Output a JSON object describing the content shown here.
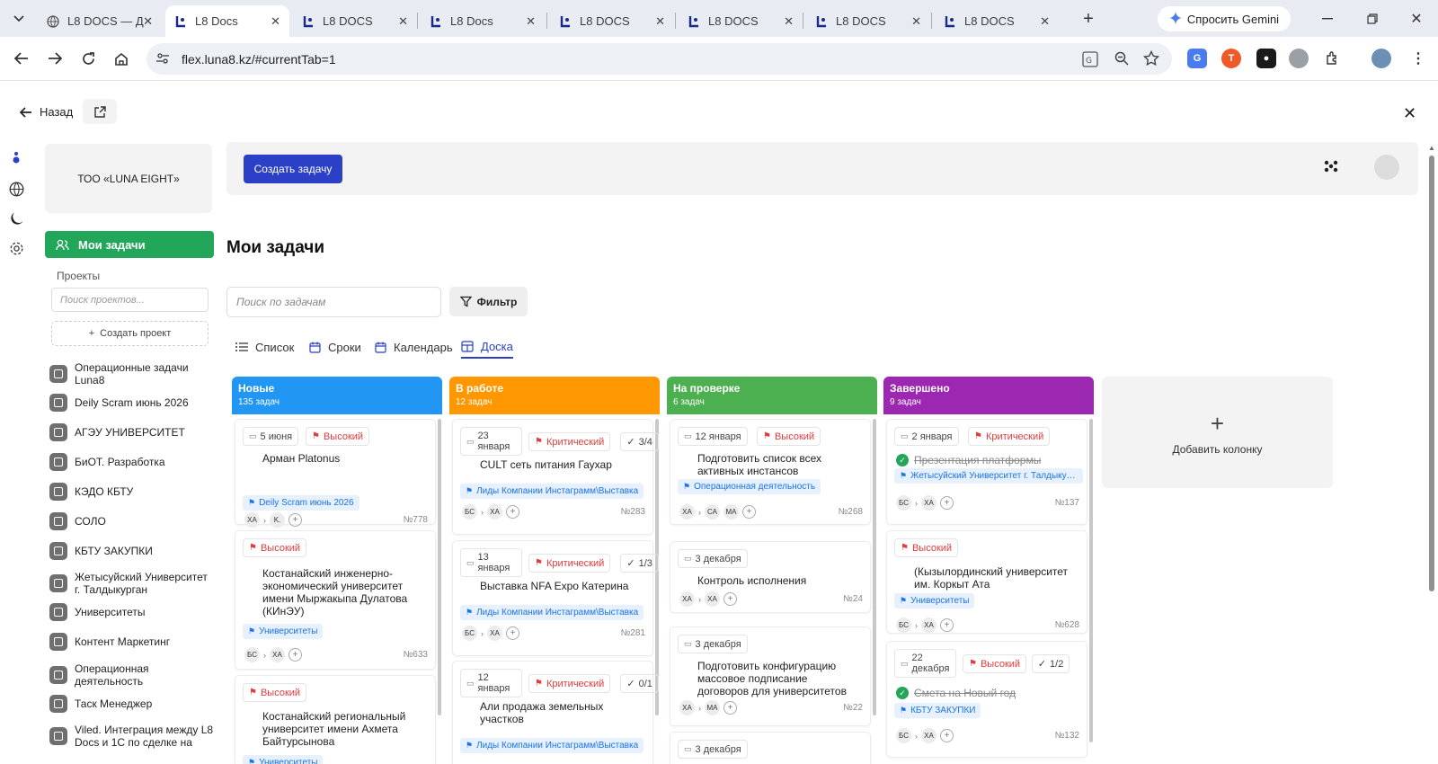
{
  "browser": {
    "tabs": [
      {
        "title": "L8 DOCS — Д",
        "fav": "globe"
      },
      {
        "title": "L8 Docs",
        "fav": "l8"
      },
      {
        "title": "L8 DOCS",
        "fav": "l8"
      },
      {
        "title": "L8 Docs",
        "fav": "l8"
      },
      {
        "title": "L8 DOCS",
        "fav": "l8"
      },
      {
        "title": "L8 DOCS",
        "fav": "l8"
      },
      {
        "title": "L8 DOCS",
        "fav": "l8"
      },
      {
        "title": "L8 DOCS",
        "fav": "l8"
      }
    ],
    "gemini_label": "Спросить Gemini",
    "url": "flex.luna8.kz/#currentTab=1"
  },
  "page": {
    "back_label": "Назад",
    "org_name": "ТОО «LUNA EIGHT»",
    "my_tasks_label": "Мои задачи",
    "projects_label": "Проекты",
    "project_search_placeholder": "Поиск проектов...",
    "create_project_label": "Создать проект",
    "projects": [
      "Операционные задачи Luna8",
      "Deily Scram июнь 2026",
      "АГЭУ УНИВЕРСИТЕТ",
      "БиОТ. Разработка",
      "КЭДО КБТУ",
      "СОЛО",
      "КБТУ ЗАКУПКИ",
      "Жетысуйский Университет г. Талдыкурган",
      "Университеты",
      "Контент Маркетинг",
      "Операционная деятельность",
      "Таск Менеджер",
      "Viled. Интеграция между L8 Docs и 1С по сделке на"
    ],
    "create_task_label": "Создать задачу",
    "title": "Мои задачи",
    "task_search_placeholder": "Поиск по задачам",
    "filter_label": "Фильтр",
    "view_tabs": [
      "Список",
      "Сроки",
      "Календарь",
      "Доска"
    ],
    "active_view": "Доска",
    "add_column_label": "Добавить колонку"
  },
  "board": {
    "columns": [
      {
        "title": "Новые",
        "count": "135 задач",
        "color": "#2196f3",
        "cards": [
          {
            "date": "5 июня",
            "priority": "Высокий",
            "title": "Арман Platonus",
            "tag": "Deily Scram июнь 2026",
            "people": [
              "ХА",
              "K."
            ],
            "num": "№778"
          },
          {
            "priority": "Высокий",
            "title": "Костанайский инженерно-экономический университет имени Мыржакыпа Дулатова (КИнЭУ)",
            "tag": "Университеты",
            "people": [
              "БС",
              "ХА"
            ],
            "num": "№633"
          },
          {
            "priority": "Высокий",
            "title": "Костанайский региональный университет имени Ахмета Байтурсынова",
            "tag": "Университеты"
          }
        ]
      },
      {
        "title": "В работе",
        "count": "12 задач",
        "color": "#ff9800",
        "cards": [
          {
            "date": "23 января",
            "priority": "Критический",
            "checks": "3/4",
            "title": "CULT сеть питания Гаухар",
            "tag": "Лиды Компании Инстаграмм\\Выставка",
            "people": [
              "БС",
              "ХА"
            ],
            "num": "№283"
          },
          {
            "date": "13 января",
            "priority": "Критический",
            "checks": "1/3",
            "title": "Выставка NFA Expo Катерина",
            "tag": "Лиды Компании Инстаграмм\\Выставка",
            "people": [
              "БС",
              "ХА"
            ],
            "num": "№281"
          },
          {
            "date": "12 января",
            "priority": "Критический",
            "checks": "0/1",
            "title": "Али продажа земельных участков",
            "tag": "Лиды Компании Инстаграмм\\Выставка"
          }
        ]
      },
      {
        "title": "На проверке",
        "count": "6 задач",
        "color": "#4caf50",
        "cards": [
          {
            "date": "12 января",
            "priority": "Высокий",
            "title": "Подготовить список всех активных инстансов",
            "tag": "Операционная деятельность",
            "people": [
              "ХА",
              "СА",
              "МА"
            ],
            "num": "№268"
          },
          {
            "date": "3 декабря",
            "title": "Контроль исполнения",
            "people": [
              "ХА",
              "ХА"
            ],
            "num": "№24"
          },
          {
            "date": "3 декабря",
            "title": "Подготовить конфигурацию массовое подписание договоров для университетов",
            "people": [
              "ХА",
              "МА"
            ],
            "num": "№22"
          },
          {
            "date": "3 декабря"
          }
        ]
      },
      {
        "title": "Завершено",
        "count": "9 задач",
        "color": "#9c27b0",
        "cards": [
          {
            "date": "2 января",
            "priority": "Критический",
            "title": "Презентация платформы",
            "tag": "Жетысуйский Университет г. Талдыкурган",
            "people": [
              "БС",
              "ХА"
            ],
            "num": "№137"
          },
          {
            "priority": "Высокий",
            "title": "(Кызылординский университет им. Коркыт Ата",
            "tag": "Университеты",
            "people": [
              "БС",
              "ХА"
            ],
            "num": "№628"
          },
          {
            "date": "22 декабря",
            "priority": "Высокий",
            "checks": "1/2",
            "title": "Смета на Новый год",
            "tag": "КБТУ ЗАКУПКИ",
            "people": [
              "БС",
              "ХА"
            ],
            "num": "№132"
          }
        ]
      }
    ]
  }
}
